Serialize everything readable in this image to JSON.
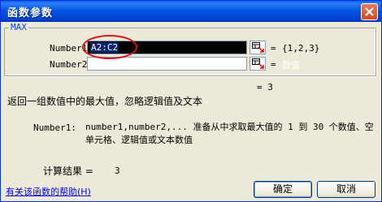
{
  "window": {
    "title": "函数参数"
  },
  "function_group": {
    "name": "MAX",
    "args": [
      {
        "label": "Number1",
        "value": "A2:C2",
        "result": "{1,2,3}"
      },
      {
        "label": "Number2",
        "value": "",
        "result": "数值"
      }
    ]
  },
  "formula_result": "= 3",
  "description": "返回一组数值中的最大值，忽略逻辑值及文本",
  "arg_help": {
    "name": "Number1:",
    "text": "number1,number2,... 准备从中求取最大值的 1 到 30 个数值、空单元格、逻辑值或文本数值"
  },
  "calc": {
    "label": "计算结果 =",
    "value": "3"
  },
  "footer": {
    "help_link": "有关该函数的帮助(H)",
    "ok_label": "确定",
    "cancel_label": "取消"
  },
  "colors": {
    "titlebar": "#0054e3",
    "annotation_circle": "#e0101a",
    "link": "#0000ff"
  }
}
